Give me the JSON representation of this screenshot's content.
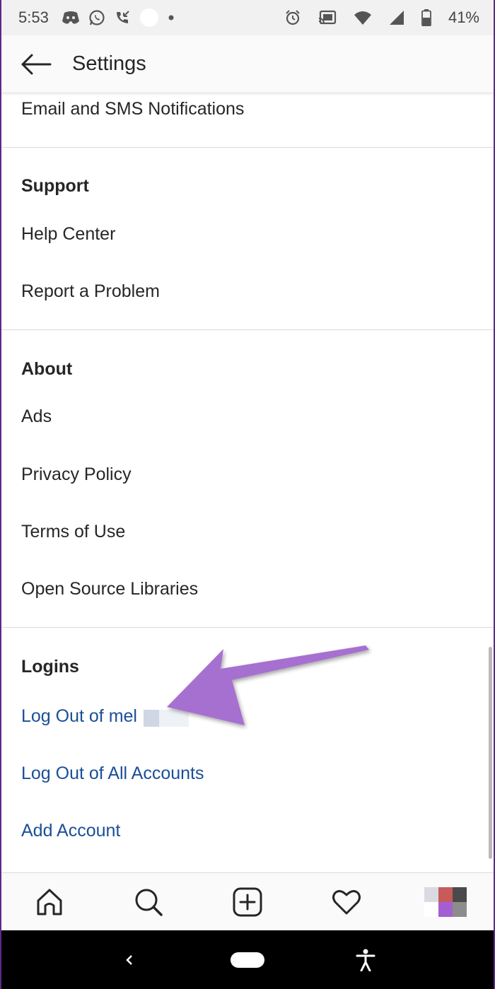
{
  "status_bar": {
    "time": "5:53",
    "battery": "41%",
    "icons_left": [
      "discord-icon",
      "whatsapp-icon",
      "missed-call-icon",
      "circle-icon",
      "dot-icon"
    ],
    "icons_right": [
      "alarm-icon",
      "cast-icon",
      "wifi-icon",
      "signal-icon",
      "battery-icon"
    ]
  },
  "header": {
    "title": "Settings"
  },
  "sections": {
    "top_item": "Email and SMS Notifications",
    "support": {
      "heading": "Support",
      "items": [
        "Help Center",
        "Report a Problem"
      ]
    },
    "about": {
      "heading": "About",
      "items": [
        "Ads",
        "Privacy Policy",
        "Terms of Use",
        "Open Source Libraries"
      ]
    },
    "logins": {
      "heading": "Logins",
      "items": [
        "Log Out of mel",
        "Log Out of All Accounts",
        "Add Account"
      ]
    }
  },
  "bottom_nav": {
    "items": [
      "home-icon",
      "search-icon",
      "add-post-icon",
      "heart-icon",
      "profile-avatar"
    ]
  },
  "colors": {
    "link_blue": "#1a4f97",
    "annotation_purple": "#a66fd0",
    "text_primary": "#262626"
  }
}
